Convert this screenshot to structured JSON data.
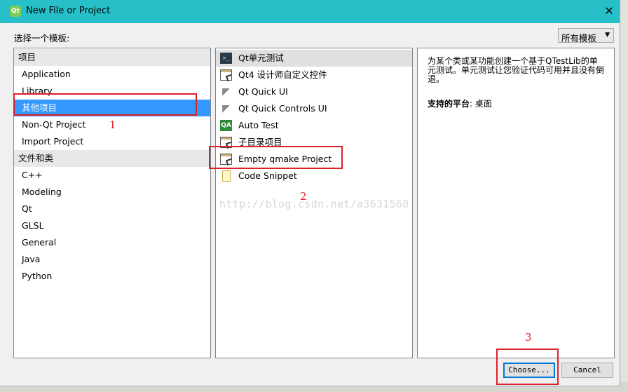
{
  "window": {
    "title": "New File or Project",
    "app_icon": "Qt",
    "close_glyph": "✕"
  },
  "header": {
    "choose_template_label": "选择一个模板:",
    "filter_value": "所有模板"
  },
  "categories": {
    "groups": [
      {
        "label": "项目",
        "items": [
          "Application",
          "Library",
          "其他项目",
          "Non-Qt Project",
          "Import Project"
        ]
      },
      {
        "label": "文件和类",
        "items": [
          "C++",
          "Modeling",
          "Qt",
          "GLSL",
          "General",
          "Java",
          "Python"
        ]
      }
    ],
    "selected": "其他项目"
  },
  "templates": {
    "items": [
      {
        "label": "Qt单元测试",
        "icon": "terminal-icon"
      },
      {
        "label": "Qt4 设计师自定义控件",
        "icon": "designer-window-icon"
      },
      {
        "label": "Qt Quick UI",
        "icon": "qt-quick-icon"
      },
      {
        "label": "Qt Quick Controls UI",
        "icon": "qt-quick-icon"
      },
      {
        "label": "Auto Test",
        "icon": "qa-icon"
      },
      {
        "label": "子目录项目",
        "icon": "window-icon"
      },
      {
        "label": "Empty qmake Project",
        "icon": "window-icon"
      },
      {
        "label": "Code Snippet",
        "icon": "note-icon"
      }
    ],
    "highlighted": "Qt单元测试"
  },
  "description": {
    "text": "为某个类或某功能创建一个基于QTestLib的单元测试。单元测试让您验证代码可用并且没有倒退。",
    "platform_label": "支持的平台",
    "platform_value": "桌面"
  },
  "buttons": {
    "choose": "Choose...",
    "cancel": "Cancel"
  },
  "annotations": [
    "1",
    "2",
    "3"
  ],
  "watermark": "http://blog.csdn.net/a3631568",
  "colors": {
    "titlebar": "#27c0c8",
    "selection": "#3399ff",
    "annotation_red": "#e0202a"
  }
}
